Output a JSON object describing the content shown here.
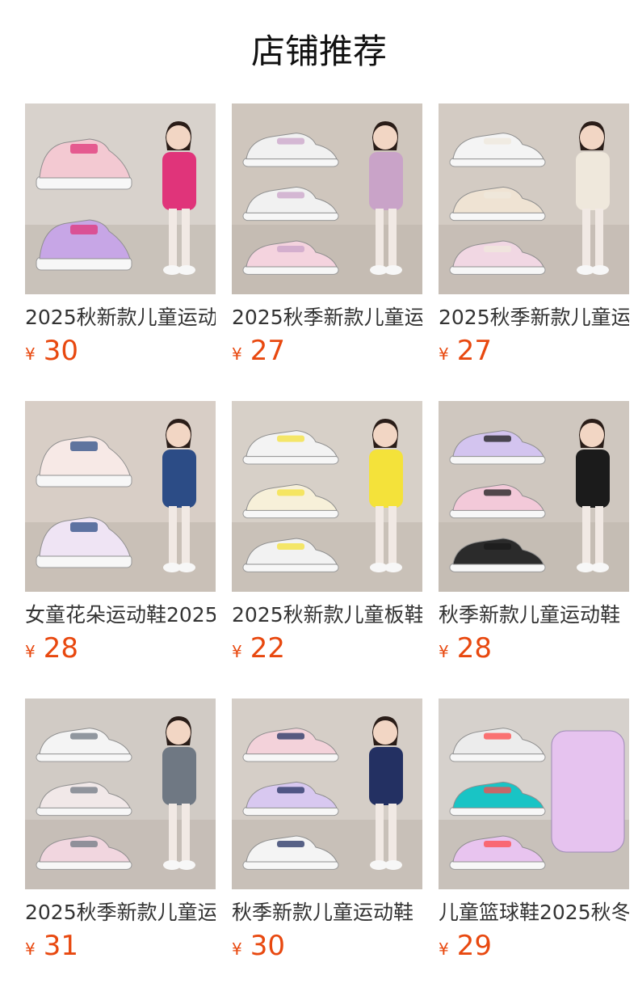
{
  "section": {
    "title": "店铺推荐"
  },
  "colors": {
    "price": "#e8480f",
    "title_text": "#333333"
  },
  "products": [
    {
      "title": "2025秋新款儿童运动",
      "currency": "¥",
      "price": "30",
      "image": "pink-purple-sneakers-girl-pink-jacket",
      "bg": "#d8d2cc",
      "shoe": [
        "#f3c9d2",
        "#c7a6e6"
      ],
      "accent": "#e0347a"
    },
    {
      "title": "2025秋季新款儿童运",
      "currency": "¥",
      "price": "27",
      "image": "three-sneakers-girl-pink-vest",
      "bg": "#cfc6bd",
      "shoe": [
        "#f1f1f1",
        "#f1f1f1",
        "#f4d3de"
      ],
      "accent": "#c9a3c8"
    },
    {
      "title": "2025秋季新款儿童运",
      "currency": "¥",
      "price": "27",
      "image": "three-sneakers-girl-hoodie",
      "bg": "#d3cbc3",
      "shoe": [
        "#f4f4f4",
        "#efe3d3",
        "#f1d7e3"
      ],
      "accent": "#efe8dc"
    },
    {
      "title": "女童花朵运动鞋2025",
      "currency": "¥",
      "price": "28",
      "image": "flower-sneakers-girl-denim-skirt",
      "bg": "#d8cec6",
      "shoe": [
        "#f7e9e6",
        "#efe4f4"
      ],
      "accent": "#2c4c86"
    },
    {
      "title": "2025秋新款儿童板鞋",
      "currency": "¥",
      "price": "22",
      "image": "skate-shoes-girl-yellow-bag",
      "bg": "#d7d0c8",
      "shoe": [
        "#f3f3f3",
        "#f7f0d9",
        "#f2f2f2"
      ],
      "accent": "#f4e23a"
    },
    {
      "title": "秋季新款儿童运动鞋",
      "currency": "¥",
      "price": "28",
      "image": "purple-pink-black-sneakers-girl-cap",
      "bg": "#cfc7bf",
      "shoe": [
        "#d3c4ef",
        "#f3c9d9",
        "#2b2b2b"
      ],
      "accent": "#1b1b1b"
    },
    {
      "title": "2025秋季新款儿童运",
      "currency": "¥",
      "price": "31",
      "image": "chunky-sneakers-girl-striped-top",
      "bg": "#d1cbc5",
      "shoe": [
        "#f4f4f4",
        "#f1e8e8",
        "#f1d6df"
      ],
      "accent": "#6f7883"
    },
    {
      "title": "秋季新款儿童运动鞋",
      "currency": "¥",
      "price": "30",
      "image": "sneakers-girl-navy-top",
      "bg": "#d5cec7",
      "shoe": [
        "#f3d2da",
        "#d8c8f0",
        "#f4f4f4"
      ],
      "accent": "#233062"
    },
    {
      "title": "儿童篮球鞋2025秋冬",
      "currency": "¥",
      "price": "29",
      "image": "basketball-shoes-colorful",
      "bg": "#d6d1cc",
      "shoe": [
        "#ececec",
        "#19c4c5",
        "#e8c4ef"
      ],
      "accent": "#ff4a4a"
    }
  ]
}
